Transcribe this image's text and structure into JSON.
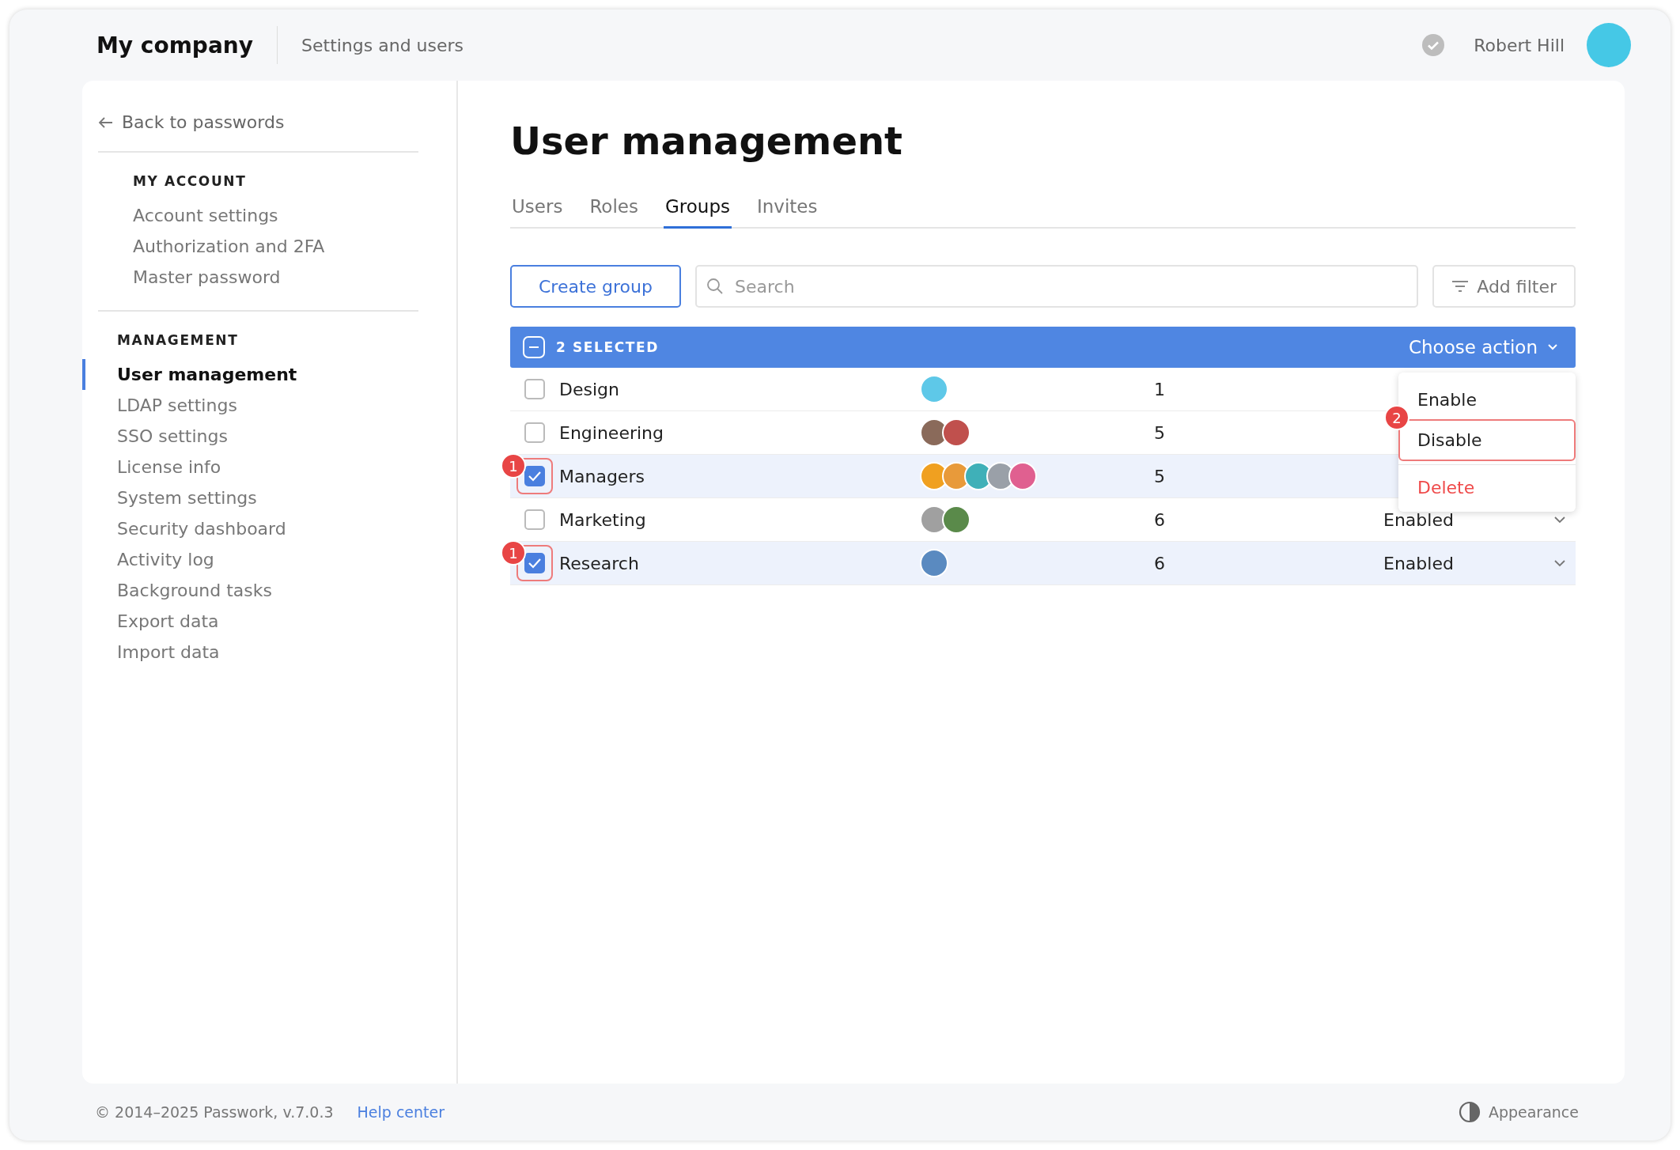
{
  "header": {
    "company": "My company",
    "section": "Settings and users",
    "user": "Robert Hill"
  },
  "sidebar": {
    "back": "Back to passwords",
    "groups": [
      {
        "heading": "MY ACCOUNT",
        "items": [
          {
            "label": "Account settings",
            "selected": false
          },
          {
            "label": "Authorization and 2FA",
            "selected": false
          },
          {
            "label": "Master password",
            "selected": false
          }
        ]
      },
      {
        "heading": "MANAGEMENT",
        "items": [
          {
            "label": "User management",
            "selected": true
          },
          {
            "label": "LDAP settings",
            "selected": false
          },
          {
            "label": "SSO settings",
            "selected": false
          },
          {
            "label": "License info",
            "selected": false
          },
          {
            "label": "System settings",
            "selected": false
          },
          {
            "label": "Security dashboard",
            "selected": false
          },
          {
            "label": "Activity log",
            "selected": false
          },
          {
            "label": "Background tasks",
            "selected": false
          },
          {
            "label": "Export data",
            "selected": false
          },
          {
            "label": "Import data",
            "selected": false
          }
        ]
      }
    ]
  },
  "page": {
    "title": "User management",
    "tabs": [
      {
        "label": "Users",
        "selected": false
      },
      {
        "label": "Roles",
        "selected": false
      },
      {
        "label": "Groups",
        "selected": true
      },
      {
        "label": "Invites",
        "selected": false
      }
    ],
    "create_button": "Create group",
    "search": {
      "placeholder": "Search"
    },
    "filter_button": "Add filter",
    "selection_bar": {
      "count": "2 SELECTED",
      "action": "Choose action"
    },
    "action_menu": [
      {
        "label": "Enable",
        "kind": "normal",
        "highlighted": false
      },
      {
        "label": "Disable",
        "kind": "normal",
        "highlighted": true,
        "callout": "2"
      },
      {
        "label": "Delete",
        "kind": "danger",
        "highlighted": false
      }
    ],
    "rows": [
      {
        "name": "Design",
        "checked": false,
        "avatars": [
          {
            "color": "#5ec8e8"
          }
        ],
        "count": "1"
      },
      {
        "name": "Engineering",
        "checked": false,
        "avatars": [
          {
            "color": "#8a6a5a"
          },
          {
            "color": "#c0504d"
          }
        ],
        "count": "5"
      },
      {
        "name": "Managers",
        "checked": true,
        "callout": "1",
        "avatars": [
          {
            "color": "#f0a020"
          },
          {
            "color": "#e89a3a"
          },
          {
            "color": "#3fb0b8"
          },
          {
            "color": "#9aa0a8"
          },
          {
            "color": "#e06090"
          }
        ],
        "count": "5"
      },
      {
        "name": "Marketing",
        "checked": false,
        "avatars": [
          {
            "color": "#a0a0a0"
          },
          {
            "color": "#5a8a4a"
          }
        ],
        "count": "6",
        "status": "Enabled"
      },
      {
        "name": "Research",
        "checked": true,
        "callout": "1",
        "avatars": [
          {
            "color": "#5a8ac0"
          }
        ],
        "count": "6",
        "status": "Enabled"
      }
    ]
  },
  "footer": {
    "copyright": "© 2014–2025 Passwork, v.7.0.3",
    "help": "Help center",
    "appearance": "Appearance"
  }
}
